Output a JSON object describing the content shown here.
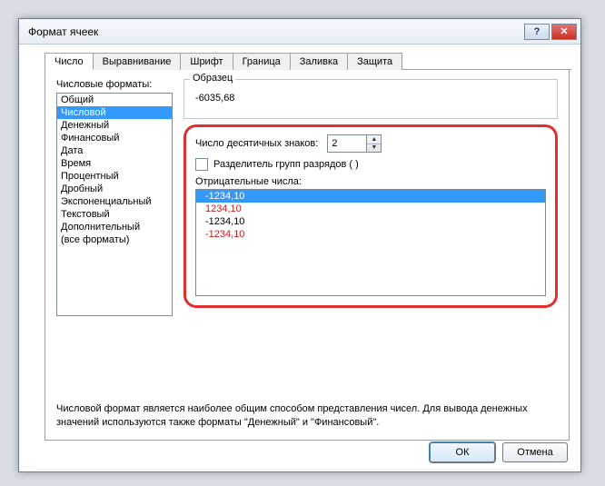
{
  "window": {
    "title": "Формат ячеек"
  },
  "tabs": [
    "Число",
    "Выравнивание",
    "Шрифт",
    "Граница",
    "Заливка",
    "Защита"
  ],
  "categories": {
    "label": "Числовые форматы:",
    "items": [
      "Общий",
      "Числовой",
      "Денежный",
      "Финансовый",
      "Дата",
      "Время",
      "Процентный",
      "Дробный",
      "Экспоненциальный",
      "Текстовый",
      "Дополнительный",
      "(все форматы)"
    ],
    "selected_index": 1
  },
  "sample": {
    "legend": "Образец",
    "value": "-6035,68"
  },
  "decimals": {
    "label": "Число десятичных знаков:",
    "value": "2"
  },
  "separator": {
    "label": "Разделитель групп разрядов ( )"
  },
  "negatives": {
    "label": "Отрицательные числа:",
    "items": [
      {
        "text": "-1234,10",
        "red": false,
        "selected": true
      },
      {
        "text": "1234,10",
        "red": true,
        "selected": false
      },
      {
        "text": "-1234,10",
        "red": false,
        "selected": false
      },
      {
        "text": "-1234,10",
        "red": true,
        "selected": false
      }
    ]
  },
  "description": "Числовой формат является наиболее общим способом представления чисел. Для вывода денежных значений используются также форматы \"Денежный\" и \"Финансовый\".",
  "buttons": {
    "ok": "ОК",
    "cancel": "Отмена"
  }
}
